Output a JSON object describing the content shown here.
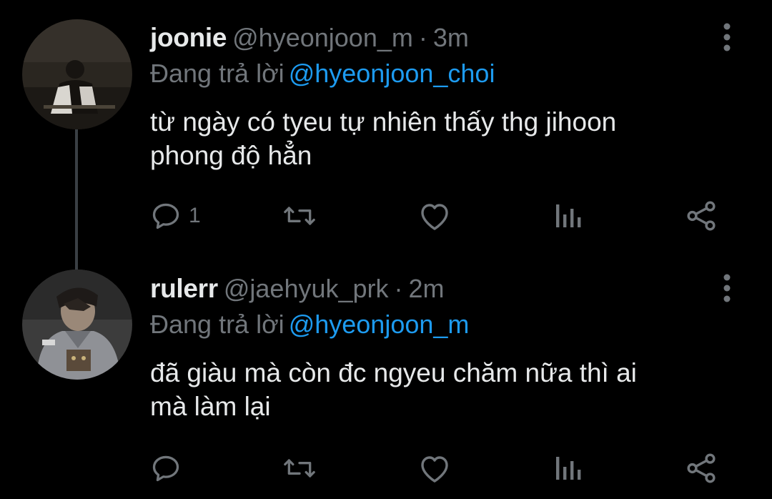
{
  "tweets": [
    {
      "display_name": "joonie",
      "handle": "@hyeonjoon_m",
      "separator": "·",
      "time": "3m",
      "reply_prefix": "Đang trả lời",
      "reply_to": "@hyeonjoon_choi",
      "text": "từ ngày có tyeu tự nhiên thấy thg jihoon\nphong độ hẳn",
      "actions": {
        "reply_count": "1",
        "retweet_count": "",
        "like_count": ""
      },
      "avatar_icon": "avatar-photo"
    },
    {
      "display_name": "rulerr",
      "handle": "@jaehyuk_prk",
      "separator": "·",
      "time": "2m",
      "reply_prefix": "Đang trả lời",
      "reply_to": "@hyeonjoon_m",
      "text": "đã giàu mà còn đc ngyeu chăm nữa thì ai\nmà làm lại",
      "actions": {
        "reply_count": "",
        "retweet_count": "",
        "like_count": ""
      },
      "avatar_icon": "avatar-photo"
    }
  ],
  "icons": {
    "more": "more-vertical-icon",
    "reply": "reply-bubble-icon",
    "retweet": "retweet-icon",
    "like": "heart-icon",
    "views": "views-bar-icon",
    "share": "share-icon"
  },
  "colors": {
    "background": "#000000",
    "primary_text": "#e7e9ea",
    "secondary_text": "#71767b",
    "mention": "#1d9bf0",
    "thread_line": "#3a3f44"
  }
}
